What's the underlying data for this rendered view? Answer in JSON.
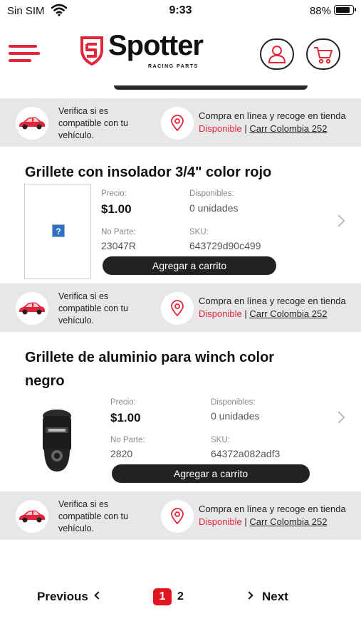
{
  "status_bar": {
    "carrier": "Sin SIM",
    "time": "9:33",
    "battery_percent": "88%",
    "battery_level": 0.88,
    "icons": [
      "wifi-icon",
      "battery-icon"
    ]
  },
  "header": {
    "brand": "Spotter",
    "brand_sub": "RACING PARTS",
    "brand_color": "#e1263a",
    "icons": [
      "menu-icon",
      "user-icon",
      "cart-icon"
    ]
  },
  "info_strip": {
    "verify_text": "Verifica si es compatible con tu vehículo.",
    "buy_text": "Compra en línea y recoge en tienda",
    "available_text": "Disponible",
    "separator": "|",
    "store_text": "Carr Colombia 252",
    "icons": [
      "car-icon",
      "location-pin-icon"
    ]
  },
  "products": [
    {
      "title": "Grillete con insolador 3/4\" color rojo",
      "price_label": "Precio:",
      "price": "$1.00",
      "available_label": "Disponibles:",
      "available": "0 unidades",
      "part_label": "No Parte:",
      "part": "23047R",
      "sku_label": "SKU:",
      "sku": "643729d90c499",
      "add_button": "Agregar a carrito"
    },
    {
      "title": "Grillete de aluminio para winch color negro",
      "price_label": "Precio:",
      "price": "$1.00",
      "available_label": "Disponibles:",
      "available": "0 unidades",
      "part_label": "No Parte:",
      "part": "2820",
      "sku_label": "SKU:",
      "sku": "64372a082adf3",
      "add_button": "Agregar a carrito"
    }
  ],
  "pagination": {
    "previous": "Previous",
    "next": "Next",
    "pages": [
      "1",
      "2"
    ],
    "current": "1",
    "accent": "#e1141f"
  }
}
